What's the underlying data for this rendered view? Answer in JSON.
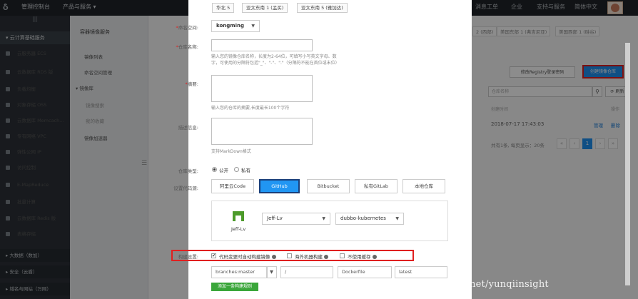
{
  "topbar": {
    "left_text": "管理控制台",
    "products": "产品与服务 ▾",
    "right_items": [
      "消息",
      "工单",
      "企业",
      "支持与服务",
      "简体中文"
    ]
  },
  "sidebar": {
    "group": "云计算基础服务",
    "items": [
      "云服务器 ECS",
      "云数据库 RDS 版",
      "负载均衡",
      "对象存储 OSS",
      "云数据库 Memcach...",
      "专有网络 VPC",
      "弹性公网 IP",
      "访问控制",
      "E-MapReduce",
      "批量计算",
      "云数据库 Redis 版",
      "表格存储"
    ],
    "bottom": [
      "大数据（数加）",
      "安全（云盾）",
      "域名与网站（万网）"
    ]
  },
  "subnav": {
    "title": "容器镜像服务",
    "links": [
      "镜像列表",
      "命名空间管理",
      "镜像库",
      "镜像搜索",
      "我的收藏",
      "镜像加速器"
    ]
  },
  "background": {
    "region_tabs": [
      "2 (西部)",
      "美国东部 1 (弗吉尼亚)",
      "美国西部 1 (硅谷)"
    ],
    "modify_password": "修改Registry登录密码",
    "create_repo": "创建镜像仓库",
    "search_placeholder": "仓库名称",
    "refresh": "刷新",
    "col_created": "创建时间",
    "col_ops": "操作",
    "row_created": "2018-07-17 17:43:03",
    "row_manage": "管理",
    "row_delete": "删除",
    "pager_text": "共有1条, 每页显示：20条",
    "page_current": "1"
  },
  "dialog": {
    "regions": [
      "华北 5",
      "亚太东南 1 (孟买)",
      "亚太东南 5 (雅加达)"
    ],
    "namespace_label": "命名空间:",
    "namespace_value": "kongming",
    "repo_name_label": "仓库名称:",
    "repo_name_hint_1": "输入您的镜像仓库名称，长度为2-64位，可填写小写英文字母、数",
    "repo_name_hint_2": "字，可使用的分隔符包括\"_\"、\"-\"、\".\"（分隔符不能在首位或末位）",
    "summary_label": "摘要:",
    "summary_hint": "输入您的仓库的摘要,长度最长100个字符",
    "desc_label": "描述信息:",
    "desc_hint": "支持MarkDown格式",
    "type_label": "仓库类型:",
    "type_public": "公开",
    "type_private": "私有",
    "source_label": "设置代码源:",
    "sources": [
      "阿里云Code",
      "GitHub",
      "Bitbucket",
      "私有GitLab",
      "本地仓库"
    ],
    "github_user": "Jeff-Lv",
    "account_select": "Jeff-Lv",
    "repo_select": "dubbo-kubernetes",
    "build_label": "构建设置:",
    "build_opt1": "代码变更时自动构建镜像",
    "build_opt2": "海外机器构建",
    "build_opt3": "不使用缓存",
    "rule_branch": "branches:master",
    "rule_path": "/",
    "rule_dockerfile": "Dockerfile",
    "rule_tag": "latest",
    "add_rule": "添加一条构建规则"
  },
  "watermark": "https://blog.csdn.net/yunqiinsight"
}
